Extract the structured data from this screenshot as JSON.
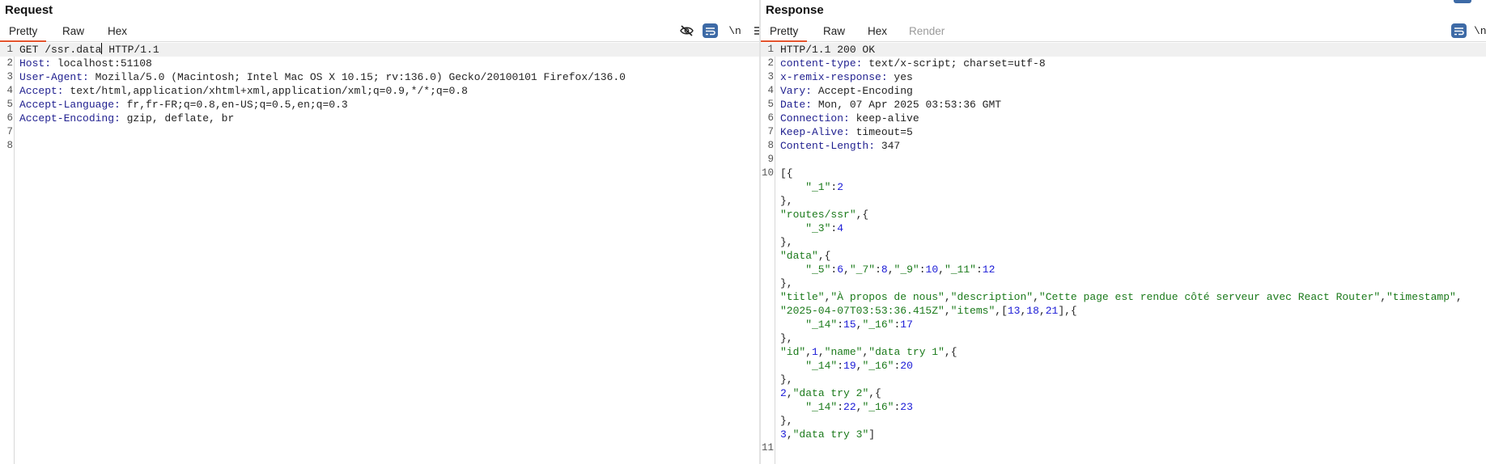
{
  "request": {
    "title": "Request",
    "tabs": [
      "Pretty",
      "Raw",
      "Hex"
    ],
    "newline_label": "\\n",
    "line_numbers": [
      "1",
      "2",
      "3",
      "4",
      "5",
      "6",
      "7",
      "8"
    ],
    "lines": [
      [
        {
          "t": "GET /ssr.data",
          "c": "pl"
        },
        {
          "t": "|",
          "c": "caret"
        },
        {
          "t": " HTTP/1.1",
          "c": "pl"
        }
      ],
      [
        {
          "t": "Host:",
          "c": "hk"
        },
        {
          "t": " localhost:51108",
          "c": "pl"
        }
      ],
      [
        {
          "t": "User-Agent:",
          "c": "hk"
        },
        {
          "t": " Mozilla/5.0 (Macintosh; Intel Mac OS X 10.15; rv:136.0) Gecko/20100101 Firefox/136.0",
          "c": "pl"
        }
      ],
      [
        {
          "t": "Accept:",
          "c": "hk"
        },
        {
          "t": " text/html,application/xhtml+xml,application/xml;q=0.9,*/*;q=0.8",
          "c": "pl"
        }
      ],
      [
        {
          "t": "Accept-Language:",
          "c": "hk"
        },
        {
          "t": " fr,fr-FR;q=0.8,en-US;q=0.5,en;q=0.3",
          "c": "pl"
        }
      ],
      [
        {
          "t": "Accept-Encoding:",
          "c": "hk"
        },
        {
          "t": " gzip, deflate, br",
          "c": "pl"
        }
      ],
      [],
      []
    ]
  },
  "response": {
    "title": "Response",
    "tabs": [
      "Pretty",
      "Raw",
      "Hex",
      "Render"
    ],
    "newline_label": "\\n",
    "line_numbers": [
      "1",
      "2",
      "3",
      "4",
      "5",
      "6",
      "7",
      "8",
      "9",
      "10",
      "",
      "",
      "",
      "",
      "",
      "",
      "",
      "",
      "",
      "",
      "",
      "",
      "",
      "",
      "",
      "",
      "",
      "",
      "",
      "11"
    ],
    "lines": [
      [
        {
          "t": "HTTP/1.1 200 OK",
          "c": "pl"
        }
      ],
      [
        {
          "t": "content-type:",
          "c": "hk"
        },
        {
          "t": " text/x-script; charset=utf-8",
          "c": "pl"
        }
      ],
      [
        {
          "t": "x-remix-response:",
          "c": "hk"
        },
        {
          "t": " yes",
          "c": "pl"
        }
      ],
      [
        {
          "t": "Vary:",
          "c": "hk"
        },
        {
          "t": " Accept-Encoding",
          "c": "pl"
        }
      ],
      [
        {
          "t": "Date:",
          "c": "hk"
        },
        {
          "t": " Mon, 07 Apr 2025 03:53:36 GMT",
          "c": "pl"
        }
      ],
      [
        {
          "t": "Connection:",
          "c": "hk"
        },
        {
          "t": " keep-alive",
          "c": "pl"
        }
      ],
      [
        {
          "t": "Keep-Alive:",
          "c": "hk"
        },
        {
          "t": " timeout=5",
          "c": "pl"
        }
      ],
      [
        {
          "t": "Content-Length:",
          "c": "hk"
        },
        {
          "t": " 347",
          "c": "pl"
        }
      ],
      [],
      [
        {
          "t": "[{",
          "c": "pl"
        }
      ],
      [
        {
          "t": "    \"_1\"",
          "c": "str"
        },
        {
          "t": ":",
          "c": "pl"
        },
        {
          "t": "2",
          "c": "num"
        }
      ],
      [
        {
          "t": "},",
          "c": "pl"
        }
      ],
      [
        {
          "t": "\"routes/ssr\"",
          "c": "str"
        },
        {
          "t": ",{",
          "c": "pl"
        }
      ],
      [
        {
          "t": "    \"_3\"",
          "c": "str"
        },
        {
          "t": ":",
          "c": "pl"
        },
        {
          "t": "4",
          "c": "num"
        }
      ],
      [
        {
          "t": "},",
          "c": "pl"
        }
      ],
      [
        {
          "t": "\"data\"",
          "c": "str"
        },
        {
          "t": ",{",
          "c": "pl"
        }
      ],
      [
        {
          "t": "    \"_5\"",
          "c": "str"
        },
        {
          "t": ":",
          "c": "pl"
        },
        {
          "t": "6",
          "c": "num"
        },
        {
          "t": ",",
          "c": "pl"
        },
        {
          "t": "\"_7\"",
          "c": "str"
        },
        {
          "t": ":",
          "c": "pl"
        },
        {
          "t": "8",
          "c": "num"
        },
        {
          "t": ",",
          "c": "pl"
        },
        {
          "t": "\"_9\"",
          "c": "str"
        },
        {
          "t": ":",
          "c": "pl"
        },
        {
          "t": "10",
          "c": "num"
        },
        {
          "t": ",",
          "c": "pl"
        },
        {
          "t": "\"_11\"",
          "c": "str"
        },
        {
          "t": ":",
          "c": "pl"
        },
        {
          "t": "12",
          "c": "num"
        }
      ],
      [
        {
          "t": "},",
          "c": "pl"
        }
      ],
      [
        {
          "t": "\"title\"",
          "c": "str"
        },
        {
          "t": ",",
          "c": "pl"
        },
        {
          "t": "\"À propos de nous\"",
          "c": "str"
        },
        {
          "t": ",",
          "c": "pl"
        },
        {
          "t": "\"description\"",
          "c": "str"
        },
        {
          "t": ",",
          "c": "pl"
        },
        {
          "t": "\"Cette page est rendue côté serveur avec React Router\"",
          "c": "str"
        },
        {
          "t": ",",
          "c": "pl"
        },
        {
          "t": "\"timestamp\"",
          "c": "str"
        },
        {
          "t": ",",
          "c": "pl"
        }
      ],
      [
        {
          "t": "\"2025-04-07T03:53:36.415Z\"",
          "c": "str"
        },
        {
          "t": ",",
          "c": "pl"
        },
        {
          "t": "\"items\"",
          "c": "str"
        },
        {
          "t": ",[",
          "c": "pl"
        },
        {
          "t": "13",
          "c": "num"
        },
        {
          "t": ",",
          "c": "pl"
        },
        {
          "t": "18",
          "c": "num"
        },
        {
          "t": ",",
          "c": "pl"
        },
        {
          "t": "21",
          "c": "num"
        },
        {
          "t": "],{",
          "c": "pl"
        }
      ],
      [
        {
          "t": "    \"_14\"",
          "c": "str"
        },
        {
          "t": ":",
          "c": "pl"
        },
        {
          "t": "15",
          "c": "num"
        },
        {
          "t": ",",
          "c": "pl"
        },
        {
          "t": "\"_16\"",
          "c": "str"
        },
        {
          "t": ":",
          "c": "pl"
        },
        {
          "t": "17",
          "c": "num"
        }
      ],
      [
        {
          "t": "},",
          "c": "pl"
        }
      ],
      [
        {
          "t": "\"id\"",
          "c": "str"
        },
        {
          "t": ",",
          "c": "pl"
        },
        {
          "t": "1",
          "c": "num"
        },
        {
          "t": ",",
          "c": "pl"
        },
        {
          "t": "\"name\"",
          "c": "str"
        },
        {
          "t": ",",
          "c": "pl"
        },
        {
          "t": "\"data try 1\"",
          "c": "str"
        },
        {
          "t": ",{",
          "c": "pl"
        }
      ],
      [
        {
          "t": "    \"_14\"",
          "c": "str"
        },
        {
          "t": ":",
          "c": "pl"
        },
        {
          "t": "19",
          "c": "num"
        },
        {
          "t": ",",
          "c": "pl"
        },
        {
          "t": "\"_16\"",
          "c": "str"
        },
        {
          "t": ":",
          "c": "pl"
        },
        {
          "t": "20",
          "c": "num"
        }
      ],
      [
        {
          "t": "},",
          "c": "pl"
        }
      ],
      [
        {
          "t": "2",
          "c": "num"
        },
        {
          "t": ",",
          "c": "pl"
        },
        {
          "t": "\"data try 2\"",
          "c": "str"
        },
        {
          "t": ",{",
          "c": "pl"
        }
      ],
      [
        {
          "t": "    \"_14\"",
          "c": "str"
        },
        {
          "t": ":",
          "c": "pl"
        },
        {
          "t": "22",
          "c": "num"
        },
        {
          "t": ",",
          "c": "pl"
        },
        {
          "t": "\"_16\"",
          "c": "str"
        },
        {
          "t": ":",
          "c": "pl"
        },
        {
          "t": "23",
          "c": "num"
        }
      ],
      [
        {
          "t": "},",
          "c": "pl"
        }
      ],
      [
        {
          "t": "3",
          "c": "num"
        },
        {
          "t": ",",
          "c": "pl"
        },
        {
          "t": "\"data try 3\"",
          "c": "str"
        },
        {
          "t": "]",
          "c": "pl"
        }
      ],
      []
    ]
  },
  "colors": {
    "accent_tab": "#e4542e",
    "header_key": "#1f1f8f",
    "string": "#1b7a1b",
    "number": "#1a1ad6",
    "toggle_blue": "#3d6aa6"
  },
  "icons": [
    "eye-slash-icon",
    "wrap-lines-icon",
    "newline-icon",
    "hamburger-menu-icon"
  ]
}
